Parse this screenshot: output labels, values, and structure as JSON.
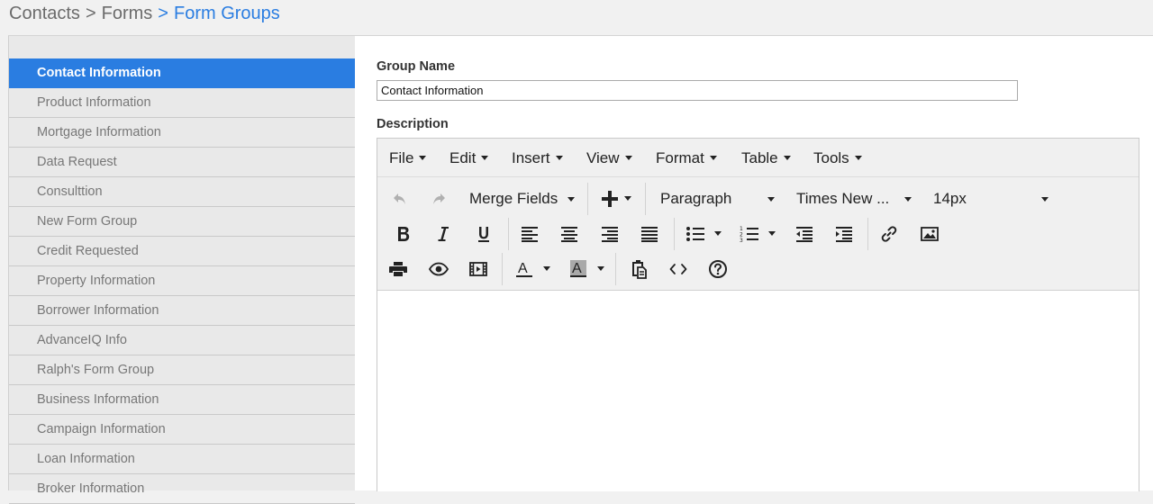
{
  "breadcrumb": {
    "items": [
      "Contacts",
      "Forms",
      "Form Groups"
    ],
    "separator": ">"
  },
  "sidebar": {
    "items": [
      {
        "label": "Contact Information",
        "active": true
      },
      {
        "label": "Product Information"
      },
      {
        "label": "Mortgage Information"
      },
      {
        "label": "Data Request"
      },
      {
        "label": "Consulttion"
      },
      {
        "label": "New Form Group"
      },
      {
        "label": "Credit Requested"
      },
      {
        "label": "Property Information"
      },
      {
        "label": "Borrower Information"
      },
      {
        "label": "AdvanceIQ Info"
      },
      {
        "label": "Ralph's Form Group"
      },
      {
        "label": "Business Information"
      },
      {
        "label": "Campaign Information"
      },
      {
        "label": "Loan Information"
      },
      {
        "label": "Broker Information"
      }
    ]
  },
  "form": {
    "group_name_label": "Group Name",
    "group_name_value": "Contact Information",
    "description_label": "Description"
  },
  "editor": {
    "menu": [
      "File",
      "Edit",
      "Insert",
      "View",
      "Format",
      "Table",
      "Tools"
    ],
    "toolbar": {
      "merge_fields": "Merge Fields",
      "block_format": "Paragraph",
      "font_family": "Times New ...",
      "font_size": "14px",
      "icons": [
        "undo-icon",
        "redo-icon",
        "insert-plus-icon",
        "bold-icon",
        "italic-icon",
        "underline-icon",
        "align-left-icon",
        "align-center-icon",
        "align-right-icon",
        "align-justify-icon",
        "bullet-list-icon",
        "numbered-list-icon",
        "outdent-icon",
        "indent-icon",
        "link-icon",
        "image-icon",
        "print-icon",
        "preview-icon",
        "media-icon",
        "text-color-icon",
        "background-color-icon",
        "paste-icon",
        "source-code-icon",
        "help-icon"
      ]
    }
  },
  "colors": {
    "accent": "#2a7de1",
    "sidebar_bg": "#e9e9e9",
    "toolbar_bg": "#f0f0f0"
  }
}
